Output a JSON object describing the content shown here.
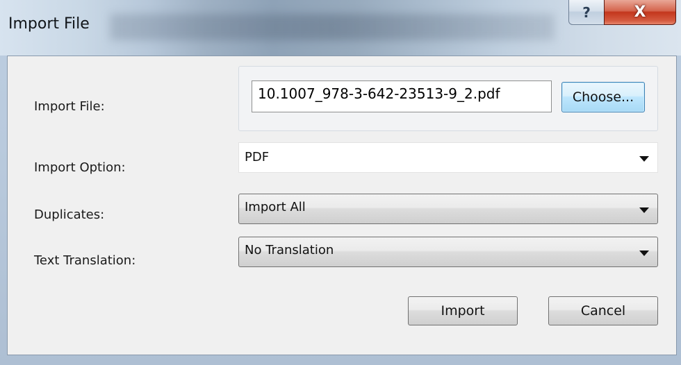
{
  "window": {
    "title": "Import File",
    "help_glyph": "?",
    "close_glyph": "X"
  },
  "form": {
    "import_file": {
      "label": "Import File:",
      "value": "10.1007_978-3-642-23513-9_2.pdf",
      "choose_label": "Choose..."
    },
    "import_option": {
      "label": "Import Option:",
      "selected": "PDF"
    },
    "duplicates": {
      "label": "Duplicates:",
      "selected": "Import All"
    },
    "text_translation": {
      "label": "Text Translation:",
      "selected": "No Translation"
    }
  },
  "actions": {
    "import_label": "Import",
    "cancel_label": "Cancel"
  },
  "icons": {
    "help": "help-icon",
    "close": "close-icon",
    "dropdown": "chevron-down-icon"
  },
  "colors": {
    "close_button": "#c3361d",
    "focus_button": "#3c7fb1"
  }
}
